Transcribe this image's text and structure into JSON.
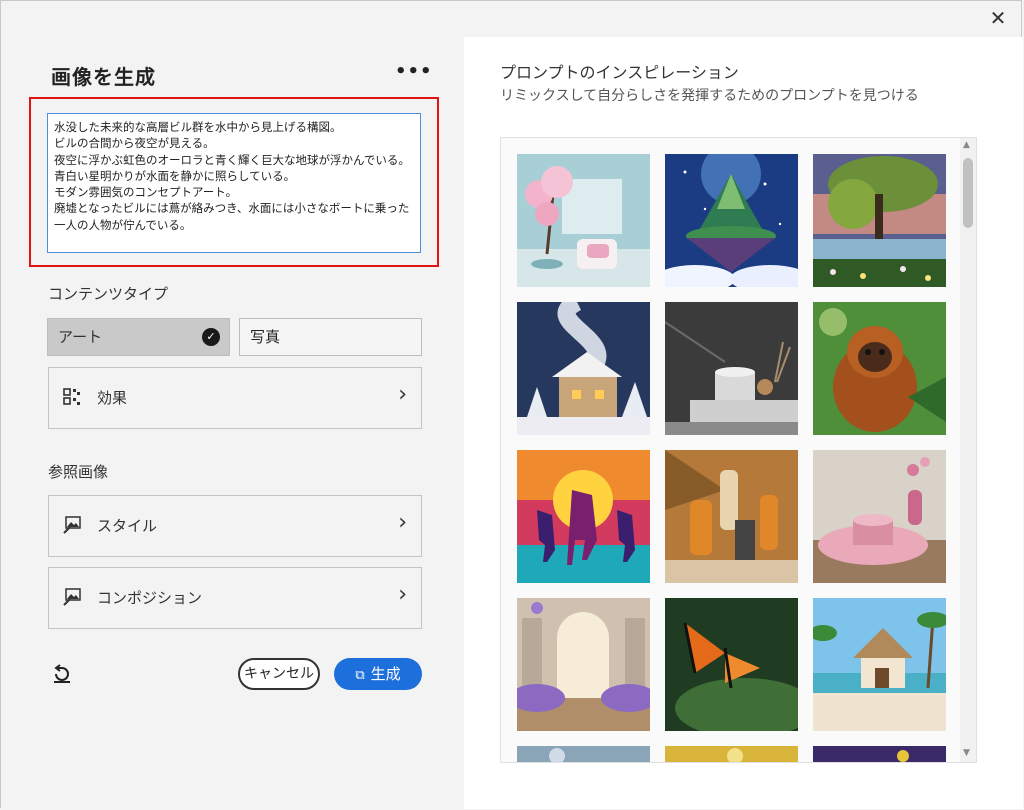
{
  "window": {
    "close_glyph": "✕"
  },
  "panel": {
    "title": "画像を生成",
    "more_glyph": "•••",
    "prompt_text": "水没した未来的な高層ビル群を水中から見上げる構図。\nビルの合間から夜空が見える。\n夜空に浮かぶ虹色のオーロラと青く輝く巨大な地球が浮かんでいる。\n青白い星明かりが水面を静かに照らしている。\nモダン雰囲気のコンセプトアート。\n廃墟となったビルには蔦が絡みつき、水面には小さなボートに乗った\n一人の人物が佇んでいる。",
    "content_type_label": "コンテンツタイプ",
    "content_types": [
      {
        "label": "アート",
        "selected": true
      },
      {
        "label": "写真",
        "selected": false
      }
    ],
    "effects_label": "効果",
    "reference_label": "参照画像",
    "style_label": "スタイル",
    "composition_label": "コンポジション",
    "cancel_label": "キャンセル",
    "generate_label": "生成",
    "accent_color": "#1d6fdc"
  },
  "inspiration": {
    "title": "プロンプトのインスピレーション",
    "subtitle": "リミックスして自分らしさを発揮するためのプロンプトを見つける",
    "tiles": [
      {
        "icon": "cherry-blossom-room"
      },
      {
        "icon": "floating-island"
      },
      {
        "icon": "willow-tree-lake"
      },
      {
        "icon": "snowy-cottage"
      },
      {
        "icon": "marble-podium"
      },
      {
        "icon": "orangutan"
      },
      {
        "icon": "neon-horses"
      },
      {
        "icon": "cosmetic-bottles"
      },
      {
        "icon": "pink-podium"
      },
      {
        "icon": "lavender-hall"
      },
      {
        "icon": "butterfly"
      },
      {
        "icon": "beach-hut"
      },
      {
        "icon": "partial-1"
      },
      {
        "icon": "partial-2"
      },
      {
        "icon": "partial-3"
      }
    ]
  }
}
